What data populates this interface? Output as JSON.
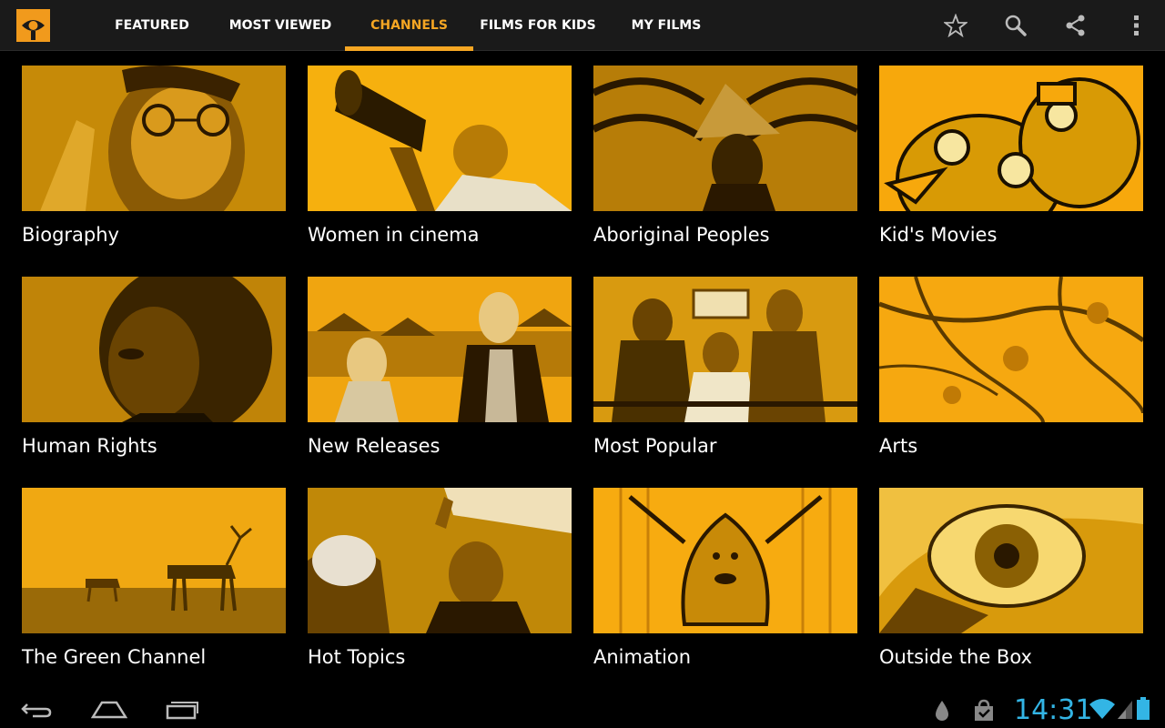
{
  "actionbar": {
    "tabs": [
      {
        "label": "FEATURED",
        "selected": false
      },
      {
        "label": "MOST VIEWED",
        "selected": false
      },
      {
        "label": "CHANNELS",
        "selected": true
      },
      {
        "label": "FILMS FOR KIDS",
        "selected": false
      },
      {
        "label": "MY FILMS",
        "selected": false
      }
    ],
    "actions": [
      "star-icon",
      "search-icon",
      "share-icon",
      "overflow-menu-icon"
    ]
  },
  "channels": [
    {
      "title": "Biography"
    },
    {
      "title": "Women in cinema"
    },
    {
      "title": "Aboriginal Peoples"
    },
    {
      "title": "Kid's Movies"
    },
    {
      "title": "Human Rights"
    },
    {
      "title": "New Releases"
    },
    {
      "title": "Most Popular"
    },
    {
      "title": "Arts"
    },
    {
      "title": "The Green Channel"
    },
    {
      "title": "Hot Topics"
    },
    {
      "title": "Animation"
    },
    {
      "title": "Outside the Box"
    }
  ],
  "statusbar": {
    "time": "14:31",
    "icons": [
      "notification-drop-icon",
      "shopping-bag-icon",
      "wifi-icon",
      "signal-icon",
      "battery-icon"
    ]
  },
  "colors": {
    "accent": "#f5a623",
    "actionbar_bg": "#1a1a1a",
    "clock": "#33b5e5",
    "thumb_tint": "#f2a40e"
  }
}
